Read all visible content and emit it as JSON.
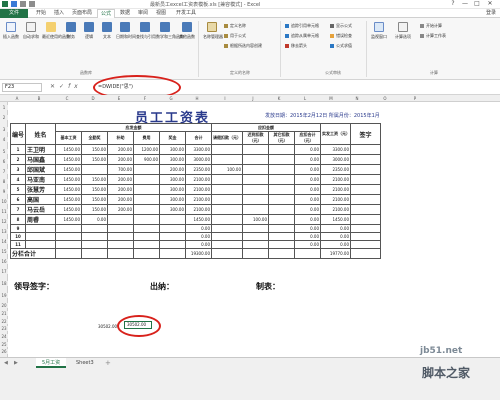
{
  "window": {
    "title": "最新员工excel工资表模板.xls [兼容模式] - Excel",
    "controls": [
      "?",
      "—",
      "□",
      "✕"
    ]
  },
  "tabs": {
    "file": "文件",
    "items": [
      "开始",
      "插入",
      "页面布局",
      "公式",
      "数据",
      "审阅",
      "视图",
      "开发工具"
    ],
    "active": "公式",
    "login": "登录"
  },
  "ribbon": {
    "big_buttons": [
      "插入函数",
      "自动求和",
      "最近使用的函数",
      "财务",
      "逻辑",
      "文本",
      "日期和时间",
      "查找与引用",
      "数学和三角函数",
      "其他函数",
      "名称管理器"
    ],
    "small_buttons": [
      "定义名称",
      "用于公式",
      "根据所选内容创建",
      "追踪引用单元格",
      "追踪从属单元格",
      "移去箭头",
      "显示公式",
      "错误检查",
      "公式求值",
      "监视窗口",
      "计算选项",
      "开始计算",
      "计算工作表"
    ],
    "groups": [
      "函数库",
      "定义的名称",
      "公式审核",
      "计算"
    ]
  },
  "formula_bar": {
    "name_box": "F23",
    "formula": "=DWIDE(\"思\")",
    "fx_label": "fx"
  },
  "grid": {
    "col_headers": [
      "A",
      "B",
      "C",
      "D",
      "E",
      "F",
      "G",
      "H",
      "I",
      "J",
      "K",
      "L",
      "M",
      "N",
      "O",
      "P"
    ],
    "row_headers": [
      "1",
      "2",
      "3",
      "4",
      "5",
      "6",
      "7",
      "8",
      "9",
      "10",
      "11",
      "12",
      "13",
      "14",
      "15",
      "16",
      "17",
      "18",
      "19",
      "20",
      "21",
      "22",
      "23",
      "24",
      "25",
      "26"
    ]
  },
  "sheet": {
    "title": "员工工资表",
    "date_label": "发放日期：2015年2月12日 所属月份：2015年1月",
    "header": {
      "no": "编号",
      "name": "姓名",
      "should_pay": "应发金额",
      "deduct": "应扣金额",
      "actual": "实发工资（元）",
      "sign": "签字",
      "sub": [
        "基本工资",
        "全勤奖",
        "补助",
        "费用",
        "奖金",
        "合计",
        "请假扣款（元）",
        "迟到扣款（元）",
        "其它扣款（元）",
        "应扣合计（元）"
      ]
    },
    "rows": [
      {
        "no": "1",
        "name": "王卫明",
        "cells": [
          "1450.00",
          "150.00",
          "200.00",
          "1200.00",
          "300.00",
          "3300.00",
          "",
          "",
          "",
          "0.00",
          "3300.00"
        ]
      },
      {
        "no": "2",
        "name": "马国鑫",
        "cells": [
          "1450.00",
          "150.00",
          "200.00",
          "900.00",
          "300.00",
          "3000.00",
          "",
          "",
          "",
          "0.00",
          "3000.00"
        ]
      },
      {
        "no": "3",
        "name": "邱国斌",
        "cells": [
          "1450.00",
          "",
          "700.00",
          "",
          "200.00",
          "2350.00",
          "100.00",
          "",
          "",
          "0.00",
          "2350.00"
        ]
      },
      {
        "no": "4",
        "name": "马亚南",
        "cells": [
          "1450.00",
          "150.00",
          "200.00",
          "",
          "300.00",
          "2100.00",
          "",
          "",
          "",
          "0.00",
          "2100.00"
        ]
      },
      {
        "no": "5",
        "name": "张慧芳",
        "cells": [
          "1450.00",
          "150.00",
          "200.00",
          "",
          "300.00",
          "2100.00",
          "",
          "",
          "",
          "0.00",
          "2100.00"
        ]
      },
      {
        "no": "6",
        "name": "高国",
        "cells": [
          "1450.00",
          "150.00",
          "200.00",
          "",
          "300.00",
          "2100.00",
          "",
          "",
          "",
          "0.00",
          "2100.00"
        ]
      },
      {
        "no": "7",
        "name": "马云岳",
        "cells": [
          "1450.00",
          "150.00",
          "200.00",
          "",
          "300.00",
          "2100.00",
          "",
          "",
          "",
          "0.00",
          "2100.00"
        ]
      },
      {
        "no": "8",
        "name": "周睿",
        "cells": [
          "1450.00",
          "0.00",
          "",
          "",
          "",
          "1450.00",
          "",
          "100.00",
          "",
          "0.00",
          "1450.00"
        ]
      },
      {
        "no": "9",
        "name": "",
        "cells": [
          "",
          "",
          "",
          "",
          "",
          "0.00",
          "",
          "",
          "",
          "0.00",
          "0.00"
        ]
      },
      {
        "no": "10",
        "name": "",
        "cells": [
          "",
          "",
          "",
          "",
          "",
          "0.00",
          "",
          "",
          "",
          "0.00",
          "0.00"
        ]
      },
      {
        "no": "11",
        "name": "",
        "cells": [
          "",
          "",
          "",
          "",
          "",
          "0.00",
          "",
          "",
          "",
          "0.00",
          "0.00"
        ]
      }
    ],
    "total": {
      "label": "分栏合计",
      "sum": "19300.00",
      "actual": "19770.00"
    },
    "sig_leader": "领导签字：",
    "sig_cashier": "出纳：",
    "sig_maker": "制表：",
    "cell_c23": "30502.00",
    "cell_f23": "30502.00"
  },
  "sheet_tabs": {
    "items": [
      "5月工资",
      "Sheet3"
    ],
    "active": "5月工资",
    "add": "+"
  },
  "watermark": {
    "site": "jb51.net",
    "name": "脚本之家"
  },
  "colors": {
    "excel_green": "#217346",
    "annotation_red": "#d8211b",
    "title_blue": "#2a3a8c"
  }
}
